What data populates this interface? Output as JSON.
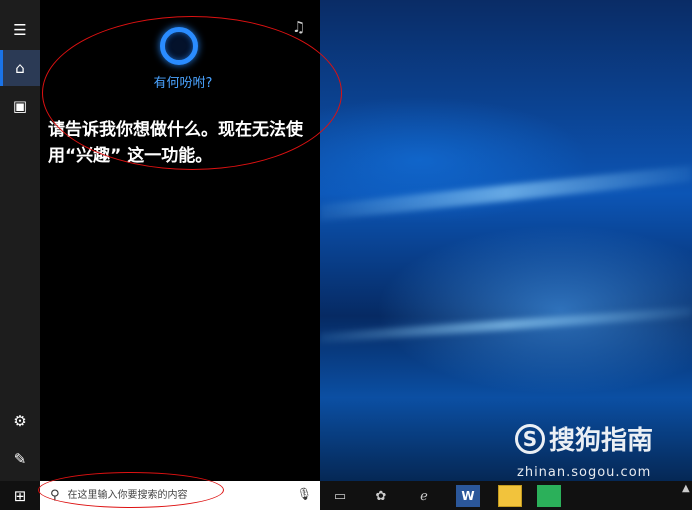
{
  "cortana": {
    "prompt": "有何吩咐?",
    "message": "请告诉我你想做什么。现在无法使用“兴趣” 这一功能。"
  },
  "taskbar": {
    "search_placeholder": "在这里输入你要搜索的内容"
  },
  "watermark": {
    "brand": "搜狗指南",
    "url": "zhinan.sogou.com"
  },
  "colors": {
    "accent": "#1a73e8",
    "cortana_ring": "#2a8cff",
    "annotation": "#dd1111"
  },
  "icons": {
    "rail": [
      "hamburger-icon",
      "home-icon",
      "notebook-icon",
      "settings-icon",
      "feedback-icon"
    ],
    "taskbar": [
      "windows-icon",
      "search-icon",
      "mic-icon",
      "task-view-icon",
      "app-icon",
      "edge-icon",
      "word-icon",
      "file-explorer-icon",
      "app-icon"
    ]
  }
}
